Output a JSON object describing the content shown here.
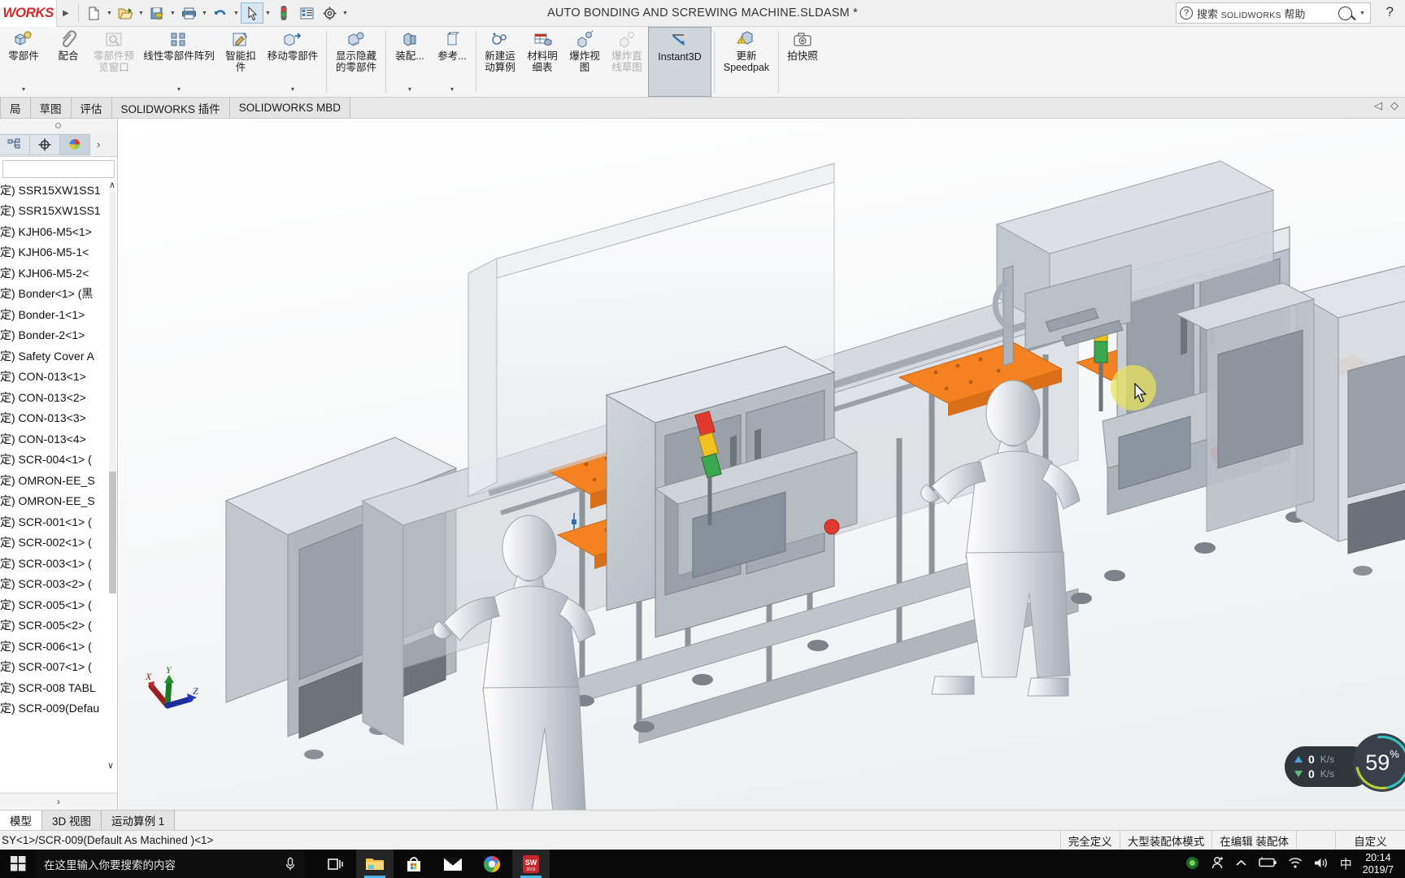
{
  "titlebar": {
    "logo": "WORKS",
    "document_title": "AUTO BONDING AND SCREWING MACHINE.SLDASM *",
    "help_placeholder_cn": "搜索 ",
    "help_placeholder_en": "SOLIDWORKS",
    "help_placeholder_cn2": " 帮助",
    "help_question": "?",
    "icons": [
      {
        "name": "new-document-icon",
        "glyph": "📄"
      },
      {
        "name": "open-document-icon",
        "glyph": "📂"
      },
      {
        "name": "save-warning-icon",
        "glyph": "💾"
      },
      {
        "name": "print-icon",
        "glyph": "🖨"
      },
      {
        "name": "undo-icon",
        "glyph": "↶"
      },
      {
        "name": "select-pointer-icon",
        "glyph": "➤"
      },
      {
        "name": "rebuild-traffic-light-icon",
        "glyph": "🚦"
      },
      {
        "name": "options-list-icon",
        "glyph": "☰"
      },
      {
        "name": "settings-gear-icon",
        "glyph": "⚙"
      }
    ]
  },
  "ribbon": {
    "items": [
      {
        "name": "insert-components",
        "label": "零部件",
        "icon": "insert-component-icon",
        "dropdown": true,
        "disabled": false
      },
      {
        "name": "mate",
        "label": "配合",
        "icon": "mate-paperclip-icon",
        "dropdown": false,
        "disabled": false
      },
      {
        "name": "component-preview-window",
        "label": "零部件预\n览窗口",
        "icon": "preview-window-icon",
        "dropdown": false,
        "disabled": true
      },
      {
        "name": "linear-component-pattern",
        "label": "线性零部件阵列",
        "icon": "linear-pattern-icon",
        "dropdown": true,
        "disabled": false
      },
      {
        "name": "smart-fasteners",
        "label": "智能扣\n件",
        "icon": "smart-fastener-icon",
        "dropdown": false,
        "disabled": false
      },
      {
        "name": "move-component",
        "label": "移动零部件",
        "icon": "move-component-icon",
        "dropdown": true,
        "disabled": false
      },
      {
        "name": "show-hidden-components",
        "label": "显示隐藏\n的零部件",
        "icon": "show-hidden-icon",
        "dropdown": false,
        "disabled": false
      },
      {
        "name": "assembly-features",
        "label": "装配...",
        "icon": "assembly-feature-icon",
        "dropdown": true,
        "disabled": false
      },
      {
        "name": "reference-geometry",
        "label": "参考...",
        "icon": "reference-geometry-icon",
        "dropdown": true,
        "disabled": false
      },
      {
        "name": "new-motion-study",
        "label": "新建运\n动算例",
        "icon": "new-motion-study-icon",
        "dropdown": false,
        "disabled": false
      },
      {
        "name": "bill-of-materials",
        "label": "材料明\n细表",
        "icon": "bom-icon",
        "dropdown": false,
        "disabled": false
      },
      {
        "name": "exploded-view",
        "label": "爆炸视\n图",
        "icon": "exploded-view-icon",
        "dropdown": false,
        "disabled": false
      },
      {
        "name": "explode-line-sketch",
        "label": "爆炸直\n线草图",
        "icon": "explode-line-icon",
        "dropdown": false,
        "disabled": true
      },
      {
        "name": "instant3d",
        "label": "Instant3D",
        "icon": "instant3d-icon",
        "dropdown": false,
        "disabled": false,
        "active": true
      },
      {
        "name": "update-speedpak",
        "label": "更新\nSpeedpak",
        "icon": "update-speedpak-icon",
        "dropdown": false,
        "disabled": false
      },
      {
        "name": "take-snapshot",
        "label": "拍快照",
        "icon": "camera-icon",
        "dropdown": false,
        "disabled": false
      }
    ]
  },
  "command_tabs": [
    {
      "name": "tab-layout",
      "label": "局"
    },
    {
      "name": "tab-sketch",
      "label": "草图"
    },
    {
      "name": "tab-evaluate",
      "label": "评估"
    },
    {
      "name": "tab-solidworks-addins",
      "label": "SOLIDWORKS 插件"
    },
    {
      "name": "tab-solidworks-mbd",
      "label": "SOLIDWORKS MBD"
    }
  ],
  "viewport_toolbar": [
    {
      "name": "zoom-to-fit-icon",
      "glyph": "🔍"
    },
    {
      "name": "zoom-to-area-icon",
      "glyph": "🔎"
    },
    {
      "name": "previous-view-icon",
      "glyph": "↶"
    },
    {
      "name": "section-view-icon",
      "glyph": "◧"
    },
    {
      "name": "view-orientation-icon",
      "glyph": "⌗"
    },
    {
      "name": "display-style-icon",
      "glyph": "▧",
      "dropdown": true
    },
    {
      "name": "hide-show-items-icon",
      "glyph": "◉",
      "dropdown": true
    },
    {
      "name": "edit-appearance-icon",
      "glyph": "🎨"
    },
    {
      "name": "apply-scene-icon",
      "glyph": "▦",
      "dropdown": true
    },
    {
      "name": "view-settings-icon",
      "glyph": "🖵"
    }
  ],
  "left_panel": {
    "tabs": [
      {
        "name": "feature-manager-tree-tab",
        "glyph": "⬚",
        "selected": false
      },
      {
        "name": "property-manager-tab",
        "glyph": "⊕",
        "selected": false
      },
      {
        "name": "display-manager-tab",
        "glyph": "◕",
        "selected": true
      }
    ],
    "expand_arrow": "›",
    "tree_items": [
      "定) SSR15XW1SS1",
      "定) SSR15XW1SS1",
      "定) KJH06-M5<1>",
      "定) KJH06-M5-1<",
      "定) KJH06-M5-2<",
      "定) Bonder<1> (黑",
      "定) Bonder-1<1>",
      "定) Bonder-2<1>",
      "定) Safety Cover A",
      "定) CON-013<1>",
      "定) CON-013<2>",
      "定) CON-013<3>",
      "定) CON-013<4>",
      "定) SCR-004<1> (",
      "定) OMRON-EE_S",
      "定) OMRON-EE_S",
      "定) SCR-001<1> (",
      "定) SCR-002<1> (",
      "定) SCR-003<1> (",
      "定) SCR-003<2> (",
      "定) SCR-005<1> (",
      "定) SCR-005<2> (",
      "定) SCR-006<1> (",
      "定) SCR-007<1> (",
      "定) SCR-008 TABL",
      "定) SCR-009(Defau"
    ],
    "scroll_up_glyph": "∧",
    "scroll_down_glyph": "∨",
    "foot_glyph": "›"
  },
  "bottom_tabs": [
    {
      "name": "tab-model",
      "label": "模型",
      "selected": true
    },
    {
      "name": "tab-3d-views",
      "label": "3D 视图",
      "selected": false
    },
    {
      "name": "tab-motion-study-1",
      "label": "运动算例 1",
      "selected": false
    }
  ],
  "statusbar": {
    "left_text": "SY<1>/SCR-009(Default  As Machined  )<1>",
    "cells": [
      {
        "name": "status-fully-defined",
        "label": "完全定义"
      },
      {
        "name": "status-large-assembly-mode",
        "label": "大型装配体模式"
      },
      {
        "name": "status-editing-assembly",
        "label": "在编辑 装配体"
      },
      {
        "name": "status-spacer",
        "label": ""
      },
      {
        "name": "status-custom",
        "label": "自定义"
      }
    ]
  },
  "overlay_widget": {
    "upload_speed": "0",
    "upload_unit": "K/s",
    "download_speed": "0",
    "download_unit": "K/s",
    "cpu_value": "59",
    "cpu_unit": "%"
  },
  "axis_triad": {
    "x": "X",
    "y": "Y",
    "z": "Z"
  },
  "taskbar": {
    "search_placeholder": "在这里输入你要搜索的内容",
    "mic_icon": "microphone-icon",
    "apps": [
      {
        "name": "task-view-icon",
        "glyph": "⌸"
      },
      {
        "name": "file-explorer-icon",
        "glyph": "📁"
      },
      {
        "name": "microsoft-store-icon",
        "glyph": "🛍"
      },
      {
        "name": "mail-icon",
        "glyph": "✉"
      },
      {
        "name": "chrome-icon",
        "glyph": "◉"
      },
      {
        "name": "solidworks-2016-icon",
        "glyph": "SW"
      }
    ],
    "tray": [
      {
        "name": "tray-nvidia-icon",
        "glyph": "◉"
      },
      {
        "name": "tray-people-icon",
        "glyph": "👥"
      },
      {
        "name": "tray-show-hidden-icon",
        "glyph": "∧"
      },
      {
        "name": "tray-battery-icon",
        "glyph": "🔋"
      },
      {
        "name": "tray-wifi-icon",
        "glyph": "◠"
      },
      {
        "name": "tray-volume-icon",
        "glyph": "🔊"
      },
      {
        "name": "tray-ime-icon",
        "glyph": "中"
      }
    ],
    "clock_time": "20:14",
    "clock_date": "2019/7"
  },
  "colors": {
    "accent_orange": "#f58220",
    "panel_grey": "#f0f0f0",
    "selection_blue": "#d8e6f2",
    "machine_grey": "#c9cdd4",
    "highlight_yellow": "#e8e25a",
    "sw_red": "#d32b2b"
  }
}
